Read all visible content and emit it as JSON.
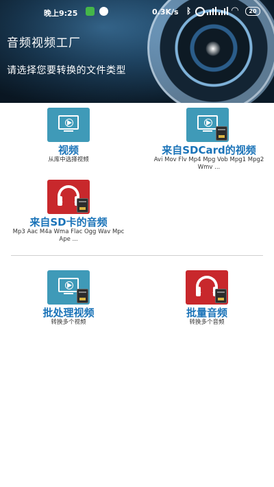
{
  "status_bar": {
    "time": "晚上9:25",
    "net_speed": "0.3K/s",
    "battery": "20",
    "icons": [
      "app-icon",
      "message-icon",
      "bluetooth-icon",
      "alarm-icon",
      "signal-icon",
      "signal-icon",
      "wifi-icon",
      "battery-icon"
    ]
  },
  "header": {
    "title": "音频视频工厂",
    "subtitle": "请选择您要转换的文件类型"
  },
  "options": [
    {
      "title": "视频",
      "desc": "从库中选择视频",
      "icon": "video-monitor-icon",
      "color": "#3f9ab8"
    },
    {
      "title": "来自SDCard的视频",
      "desc": "Avi Mov Flv Mp4 Mpg Vob Mpg1 Mpg2 Wmv ...",
      "icon": "video-monitor-sdcard-icon",
      "color": "#3f9ab8"
    },
    {
      "title": "来自SD卡的音频",
      "desc": "Mp3 Aac M4a Wma Flac Ogg Wav Mpc Ape ...",
      "icon": "headphones-sdcard-icon",
      "color": "#c8282c"
    },
    {
      "title": "批处理视频",
      "desc": "转换多个视频",
      "icon": "video-monitor-sdcard-icon",
      "color": "#3f9ab8"
    },
    {
      "title": "批量音频",
      "desc": "转换多个音频",
      "icon": "headphones-sdcard-icon",
      "color": "#c8282c"
    }
  ],
  "colors": {
    "accent_text": "#1a73b8",
    "teal_tile": "#3f9ab8",
    "red_tile": "#c8282c"
  }
}
